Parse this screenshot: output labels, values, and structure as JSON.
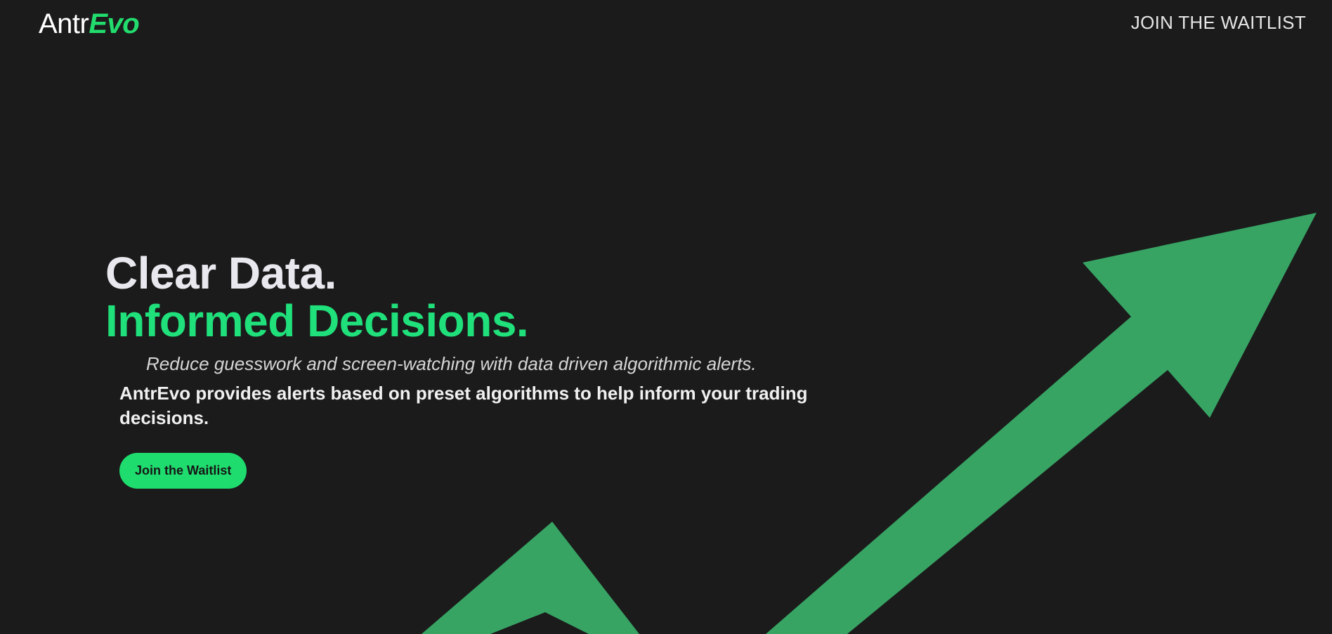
{
  "brand": {
    "name_part1": "Antr",
    "name_part2": "Evo",
    "accent_color": "#22dd6e"
  },
  "nav": {
    "waitlist_link": "JOIN THE WAITLIST"
  },
  "hero": {
    "headline_line1": "Clear Data.",
    "headline_line2": "Informed Decisions.",
    "tagline": "Reduce guesswork and screen-watching with data driven algorithmic alerts.",
    "description": "AntrEvo provides alerts based on preset algorithms to help inform your trading decisions.",
    "cta_label": "Join the Waitlist"
  },
  "theme": {
    "background": "#1b1b1b",
    "arrow_color": "#37a464",
    "button_color": "#1fdc6e"
  }
}
